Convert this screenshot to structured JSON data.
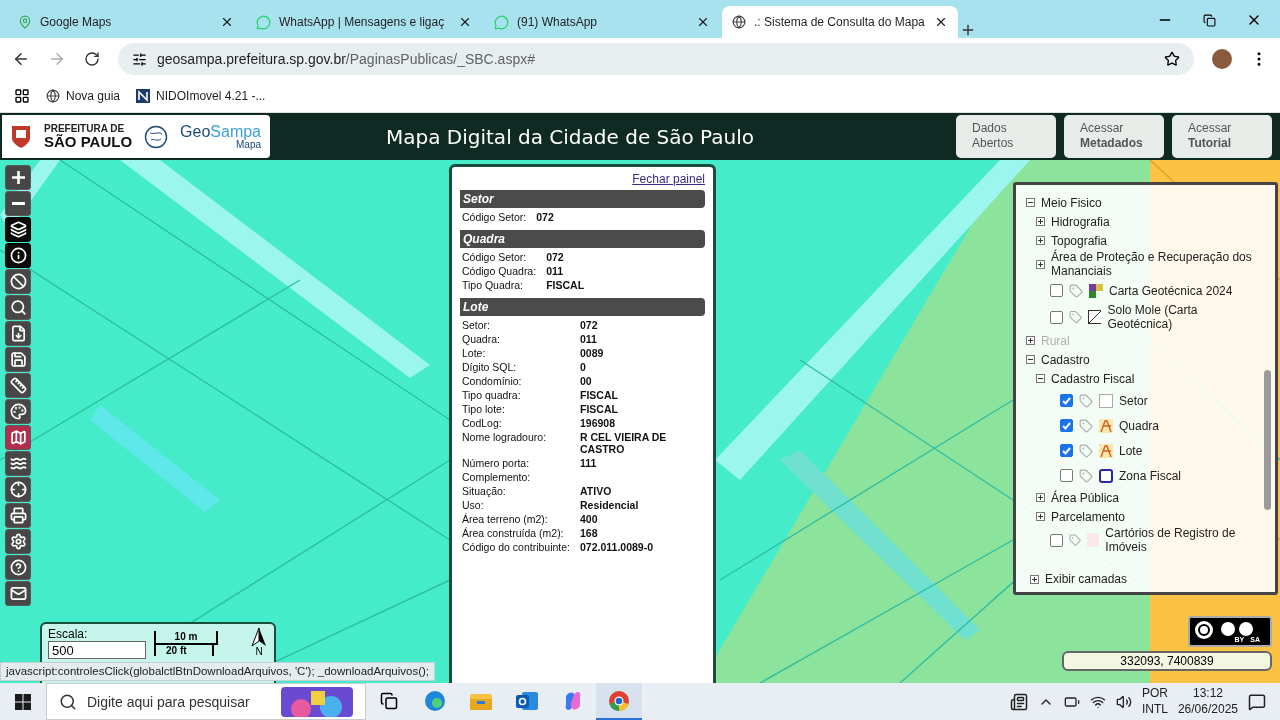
{
  "browser": {
    "tabs": [
      {
        "title": "Google Maps",
        "favicon": {
          "kind": "maps"
        },
        "selected": false
      },
      {
        "title": "WhatsApp | Mensagens e ligaç",
        "favicon": {
          "kind": "whatsapp"
        },
        "selected": false
      },
      {
        "title": "(91) WhatsApp",
        "favicon": {
          "kind": "whatsapp"
        },
        "selected": false
      },
      {
        "title": ".: Sistema de Consulta do Mapa",
        "favicon": {
          "kind": "globe"
        },
        "selected": true
      }
    ],
    "url_host": "geosampa.prefeitura.sp.gov.br",
    "url_path": "/PaginasPublicas/_SBC.aspx#",
    "bookmarks": [
      {
        "title": "Nova guia",
        "favicon": {
          "kind": "globe"
        }
      },
      {
        "title": "NIDOImovel 4.21 -...",
        "favicon": {
          "kind": "letter"
        }
      }
    ]
  },
  "header": {
    "city_line1": "PREFEITURA DE",
    "city_line2": "SÃO PAULO",
    "brand_part1": "Geo",
    "brand_part2": "Sampa",
    "brand_sub": "Mapa",
    "title": "Mapa Digital da Cidade de São Paulo",
    "links": [
      {
        "line1": "Dados",
        "line2": "Abertos",
        "bold": false
      },
      {
        "line1": "Acessar",
        "line2": "Metadados",
        "bold": true
      },
      {
        "line1": "Acessar",
        "line2": "Tutorial",
        "bold": true
      }
    ]
  },
  "toolbar": [
    {
      "kind": "zoom-in",
      "selected": false,
      "hovered": false
    },
    {
      "kind": "zoom-out",
      "selected": false,
      "hovered": false
    },
    {
      "kind": "layers",
      "selected": true,
      "hovered": false
    },
    {
      "kind": "info",
      "selected": true,
      "hovered": false
    },
    {
      "kind": "no-measure",
      "selected": false,
      "hovered": false
    },
    {
      "kind": "search",
      "selected": false,
      "hovered": false
    },
    {
      "kind": "export",
      "selected": false,
      "hovered": false
    },
    {
      "kind": "save",
      "selected": false,
      "hovered": false
    },
    {
      "kind": "ruler",
      "selected": false,
      "hovered": false
    },
    {
      "kind": "palette",
      "selected": false,
      "hovered": false
    },
    {
      "kind": "map-download",
      "selected": false,
      "hovered": true
    },
    {
      "kind": "contours",
      "selected": false,
      "hovered": false
    },
    {
      "kind": "crosshair",
      "selected": false,
      "hovered": false
    },
    {
      "kind": "print",
      "selected": false,
      "hovered": false
    },
    {
      "kind": "settings",
      "selected": false,
      "hovered": false
    },
    {
      "kind": "help",
      "selected": false,
      "hovered": false
    },
    {
      "kind": "mail",
      "selected": false,
      "hovered": false
    }
  ],
  "info_panel": {
    "close_link": "Fechar painel",
    "sections": [
      {
        "title": "Setor",
        "rows": [
          {
            "label": "Código Setor:",
            "value": "072"
          }
        ]
      },
      {
        "title": "Quadra",
        "rows": [
          {
            "label": "Código Setor:",
            "value": "072"
          },
          {
            "label": "Código Quadra:",
            "value": "011"
          },
          {
            "label": "Tipo Quadra:",
            "value": "FISCAL"
          }
        ]
      },
      {
        "title": "Lote",
        "rows": [
          {
            "label": "Setor:",
            "value": "072"
          },
          {
            "label": "Quadra:",
            "value": "011"
          },
          {
            "label": "Lote:",
            "value": "0089"
          },
          {
            "label": "Dígito SQL:",
            "value": "0"
          },
          {
            "label": "Condomínio:",
            "value": "00"
          },
          {
            "label": "Tipo quadra:",
            "value": "FISCAL"
          },
          {
            "label": "Tipo lote:",
            "value": "FISCAL"
          },
          {
            "label": "CodLog:",
            "value": "196908"
          },
          {
            "label": "Nome logradouro:",
            "value": "R CEL VIEIRA DE CASTRO"
          },
          {
            "label": "Número porta:",
            "value": "111"
          },
          {
            "label": "Complemento:"
          },
          {
            "label": "Situação:",
            "value": "ATIVO"
          },
          {
            "label": "Uso:",
            "value": "Residencial"
          },
          {
            "label": "Área terreno (m2):",
            "value": "400"
          },
          {
            "label": "Área construída (m2):",
            "value": "168"
          },
          {
            "label": "Código do contribuinte:",
            "value": "072.011.0089-0"
          }
        ]
      }
    ]
  },
  "layers": {
    "items": [
      {
        "kind": "group",
        "label": "Meio Fisico",
        "expanded": true,
        "disabled": false,
        "children": [
          {
            "kind": "group",
            "label": "Hidrografia",
            "expanded": false,
            "disabled": false
          },
          {
            "kind": "group",
            "label": "Topografia",
            "expanded": false,
            "disabled": false
          },
          {
            "kind": "group",
            "label": "Área de Proteção e Recuperação dos Mananciais",
            "expanded": false,
            "disabled": false
          },
          {
            "kind": "layer",
            "label": "Carta Geotécnica 2024",
            "checked": false,
            "legend": {
              "kind": "geo"
            }
          },
          {
            "kind": "layer",
            "label": "Solo Mole (Carta Geotécnica)",
            "checked": false,
            "legend": {
              "kind": "hatch"
            }
          }
        ]
      },
      {
        "kind": "group",
        "label": "Rural",
        "expanded": false,
        "disabled": true
      },
      {
        "kind": "group",
        "label": "Cadastro",
        "expanded": true,
        "disabled": false,
        "children": [
          {
            "kind": "group",
            "label": "Cadastro Fiscal",
            "expanded": true,
            "disabled": false,
            "children": [
              {
                "kind": "layer",
                "label": "Setor",
                "checked": true,
                "legend": {
                  "kind": "blank"
                }
              },
              {
                "kind": "layer",
                "label": "Quadra",
                "checked": true,
                "legend": {
                  "kind": "parcel"
                }
              },
              {
                "kind": "layer",
                "label": "Lote",
                "checked": true,
                "legend": {
                  "kind": "parcel"
                }
              },
              {
                "kind": "layer",
                "label": "Zona Fiscal",
                "checked": false,
                "legend": {
                  "kind": "zone"
                }
              }
            ]
          },
          {
            "kind": "group",
            "label": "Área Pública",
            "expanded": false,
            "disabled": false
          },
          {
            "kind": "group",
            "label": "Parcelamento",
            "expanded": false,
            "disabled": false
          },
          {
            "kind": "layer",
            "label": "Cartórios de Registro de Imóveis",
            "checked": false,
            "legend": {
              "kind": "pink"
            }
          }
        ]
      }
    ],
    "toggle": {
      "label": "Exibir camadas",
      "expanded": false
    }
  },
  "scale": {
    "label": "Escala:",
    "value": "500",
    "metric": "10 m",
    "imperial": "20 ft",
    "north": "N"
  },
  "license": {
    "by": "BY",
    "sa": "SA"
  },
  "coordinates": "332093, 7400839",
  "status_url": "javascript:controlesClick(globalctlBtnDownloadArquivos, 'C'); _downloadArquivos();",
  "taskbar": {
    "search_placeholder": "Digite aqui para pesquisar",
    "apps": [
      {
        "kind": "taskview",
        "selected": false
      },
      {
        "kind": "edge",
        "selected": false
      },
      {
        "kind": "explorer",
        "selected": false
      },
      {
        "kind": "outlook",
        "selected": false
      },
      {
        "kind": "copilot",
        "selected": false
      },
      {
        "kind": "chrome",
        "selected": true
      }
    ],
    "lang1": "POR",
    "lang2": "INTL",
    "time": "13:12",
    "date": "26/06/2025"
  }
}
